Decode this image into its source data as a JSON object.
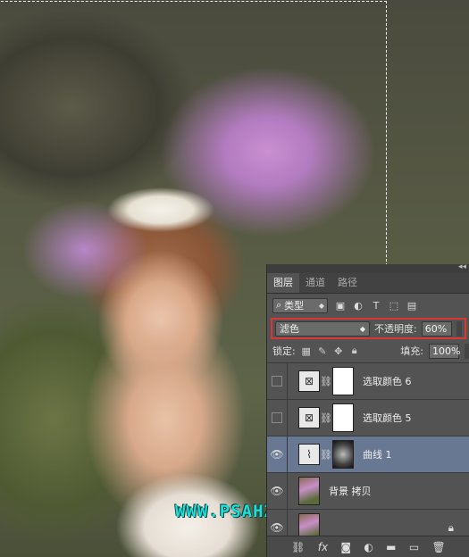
{
  "watermark": "WWW.PSAHZ.COM",
  "panel": {
    "tabs": [
      {
        "label": "图层",
        "active": true
      },
      {
        "label": "通道",
        "active": false
      },
      {
        "label": "路径",
        "active": false
      }
    ],
    "filter_kind": "类型",
    "blend_mode": "滤色",
    "opacity_label": "不透明度:",
    "opacity_value": "60%",
    "lock_label": "锁定:",
    "fill_label": "填充:",
    "fill_value": "100%",
    "layers": [
      {
        "name": "选取颜色 6",
        "visible": false,
        "type": "adjustment-selective-color"
      },
      {
        "name": "选取颜色 5",
        "visible": false,
        "type": "adjustment-selective-color"
      },
      {
        "name": "曲线 1",
        "visible": true,
        "type": "adjustment-curves",
        "selected": true
      },
      {
        "name": "背景 拷贝",
        "visible": true,
        "type": "image"
      },
      {
        "name": "",
        "visible": true,
        "type": "background-locked"
      }
    ]
  },
  "colors": {
    "highlight": "#d93535",
    "selected_layer": "#687892",
    "watermark": "#1de0d8"
  }
}
